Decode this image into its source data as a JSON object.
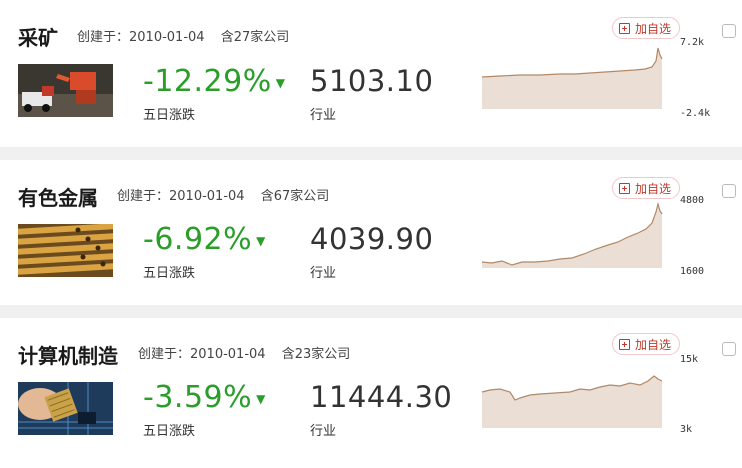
{
  "cards": [
    {
      "name": "采矿",
      "created": "创建于：2010-01-04",
      "count": "含27家公司",
      "pct": "-12.29%",
      "pct_label": "五日涨跌",
      "index": "5103.10",
      "index_label": "行业",
      "add_label": "加自选",
      "ymax": "7.2k",
      "ymin": "-2.4k",
      "thumb_icon": "mining-truck-photo"
    },
    {
      "name": "有色金属",
      "created": "创建于：2010-01-04",
      "count": "含67家公司",
      "pct": "-6.92%",
      "pct_label": "五日涨跌",
      "index": "4039.90",
      "index_label": "行业",
      "add_label": "加自选",
      "ymax": "4800",
      "ymin": "1600",
      "thumb_icon": "metal-pipes-photo"
    },
    {
      "name": "计算机制造",
      "created": "创建于：2010-01-04",
      "count": "含23家公司",
      "pct": "-3.59%",
      "pct_label": "五日涨跌",
      "index": "11444.30",
      "index_label": "行业",
      "add_label": "加自选",
      "ymax": "15k",
      "ymin": "3k",
      "thumb_icon": "circuit-board-photo"
    }
  ],
  "arrow_glyph": "▼",
  "colors": {
    "down": "#2a9d2a",
    "accent": "#c0392b",
    "spark_line": "#b08968",
    "spark_fill": "#e9dcd0"
  }
}
